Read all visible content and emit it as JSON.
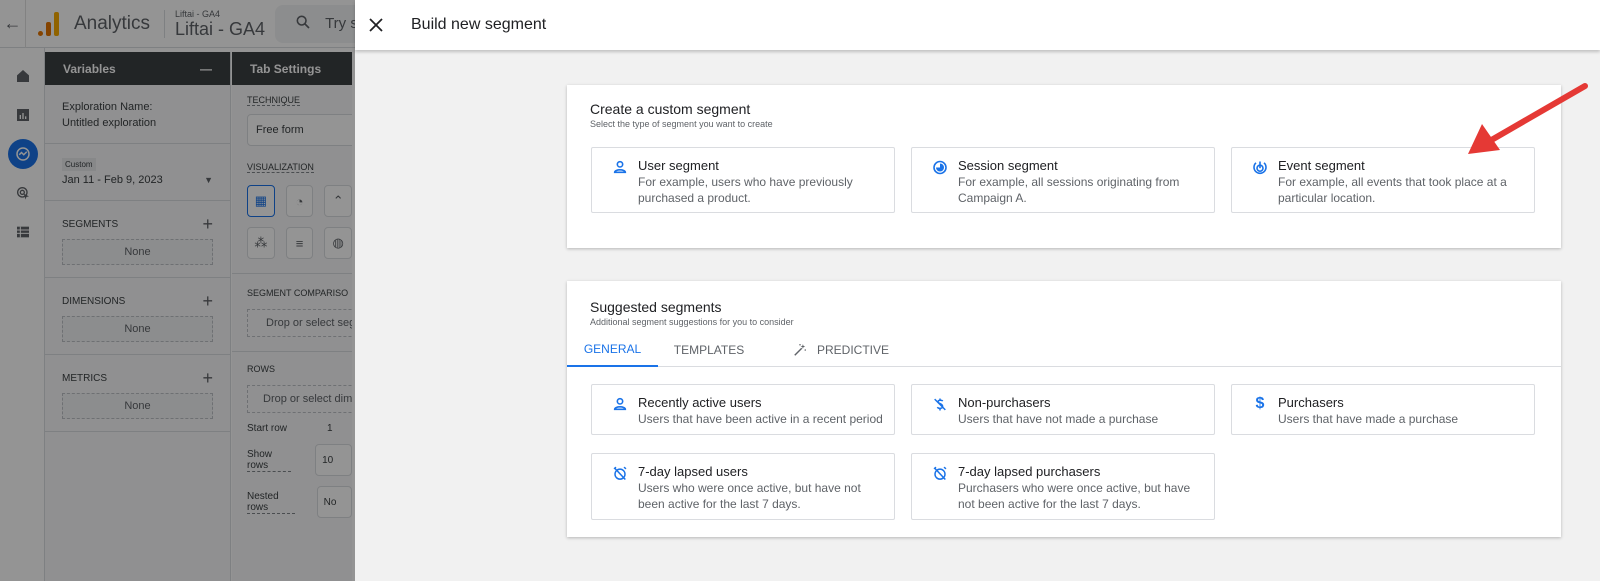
{
  "app": {
    "brand": "Analytics",
    "account_small": "Liftai - GA4",
    "account_big": "Liftai - GA4",
    "search_placeholder": "Try s",
    "colors": {
      "accent": "#1a73e8",
      "logo_orange": "#e37400",
      "logo_yellow": "#f9ab00",
      "arrow": "#e53935"
    }
  },
  "nav": {
    "items": [
      {
        "icon": "home-icon"
      },
      {
        "icon": "reports-icon"
      },
      {
        "icon": "explore-icon",
        "active": true
      },
      {
        "icon": "advertising-icon"
      },
      {
        "icon": "configure-icon"
      }
    ]
  },
  "variables": {
    "title": "Variables",
    "collapse": "—",
    "exploration_label": "Exploration Name:",
    "exploration_value": "Untitled exploration",
    "date_chip": "Custom",
    "date_range": "Jan 11 - Feb 9, 2023",
    "segments_label": "SEGMENTS",
    "segments_value": "None",
    "dimensions_label": "DIMENSIONS",
    "dimensions_value": "None",
    "metrics_label": "METRICS",
    "metrics_value": "None"
  },
  "tab_settings": {
    "title": "Tab Settings",
    "technique_label": "TECHNIQUE",
    "technique_value": "Free form",
    "visualization_label": "VISUALIZATION",
    "segment_comparisons_label": "SEGMENT COMPARISO",
    "segment_drop": "Drop or select seg",
    "rows_label": "ROWS",
    "rows_drop": "Drop or select dim",
    "start_row_label": "Start row",
    "start_row_value": "1",
    "show_rows_label": "Show rows",
    "show_rows_value": "10",
    "nested_rows_label": "Nested rows",
    "nested_rows_value": "No"
  },
  "dialog": {
    "title": "Build new segment",
    "custom": {
      "title": "Create a custom segment",
      "subtitle": "Select the type of segment you want to create",
      "options": [
        {
          "icon": "user-icon",
          "title": "User segment",
          "desc": "For example, users who have previously purchased a product."
        },
        {
          "icon": "session-icon",
          "title": "Session segment",
          "desc": "For example, all sessions originating from Campaign A."
        },
        {
          "icon": "event-icon",
          "title": "Event segment",
          "desc": "For example, all events that took place at a particular location."
        }
      ]
    },
    "suggested": {
      "title": "Suggested segments",
      "subtitle": "Additional segment suggestions for you to consider",
      "tabs": [
        {
          "label": "GENERAL",
          "active": true
        },
        {
          "label": "TEMPLATES"
        },
        {
          "label": "PREDICTIVE",
          "icon": "magic-wand-icon"
        }
      ],
      "options": [
        {
          "icon": "user-icon",
          "title": "Recently active users",
          "desc": "Users that have been active in a recent period"
        },
        {
          "icon": "no-dollar-icon",
          "title": "Non-purchasers",
          "desc": "Users that have not made a purchase"
        },
        {
          "icon": "dollar-icon",
          "title": "Purchasers",
          "desc": "Users that have made a purchase"
        },
        {
          "icon": "alarm-off-icon",
          "title": "7-day lapsed users",
          "desc": "Users who were once active, but have not been active for the last 7 days."
        },
        {
          "icon": "alarm-off-icon",
          "title": "7-day lapsed purchasers",
          "desc": "Purchasers who were once active, but have not been active for the last 7 days."
        }
      ]
    }
  }
}
